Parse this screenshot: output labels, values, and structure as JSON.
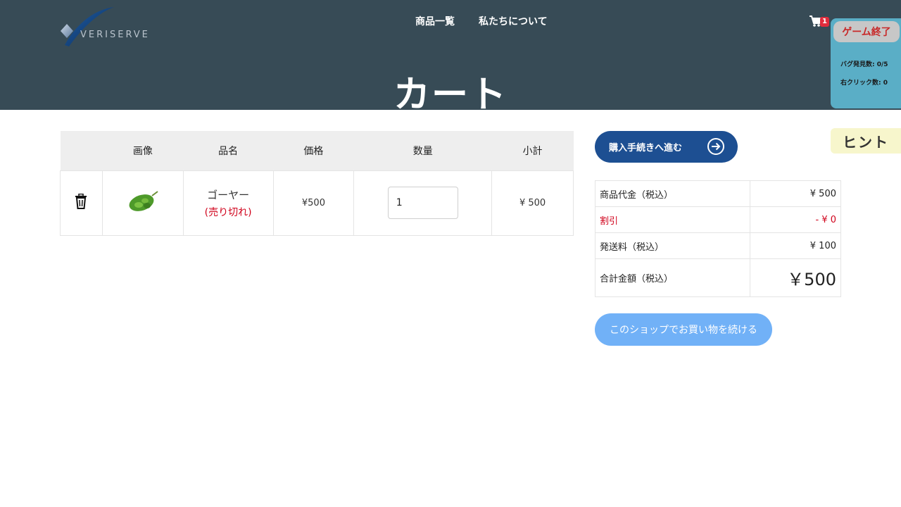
{
  "header": {
    "logo_text": "VERISERVE",
    "nav": [
      "商品一覧",
      "私たちについて"
    ],
    "cart_count": "1",
    "page_title": "カート"
  },
  "game_panel": {
    "end_label": "ゲーム終了",
    "bug_count": "バグ発見数: 0/5",
    "right_click_count": "右クリック数: 0",
    "hint_label": "ヒント"
  },
  "cart": {
    "columns": [
      "",
      "画像",
      "品名",
      "価格",
      "数量",
      "小計"
    ],
    "items": [
      {
        "name": "ゴーヤー",
        "status": "(売り切れ)",
        "price": "¥500",
        "quantity": "1",
        "subtotal": "¥ 500",
        "image_icon": "bitter-melon-image"
      }
    ]
  },
  "checkout": {
    "button_label": "購入手続きへ進む",
    "summary": [
      {
        "label": "商品代金（税込）",
        "value": "¥ 500"
      },
      {
        "label": "割引",
        "value": "- ¥ 0"
      },
      {
        "label": "発送料（税込）",
        "value": "¥ 100"
      },
      {
        "label": "合計金額（税込）",
        "value": "￥500"
      }
    ],
    "continue_label": "このショップでお買い物を続ける"
  },
  "colors": {
    "header_bg": "#374b56",
    "primary_button": "#1d4f92",
    "secondary_button": "#71b1f7",
    "discount_red": "#d0021b",
    "panel_bg": "#5aaec6",
    "hint_bg": "#f7f6cc"
  }
}
